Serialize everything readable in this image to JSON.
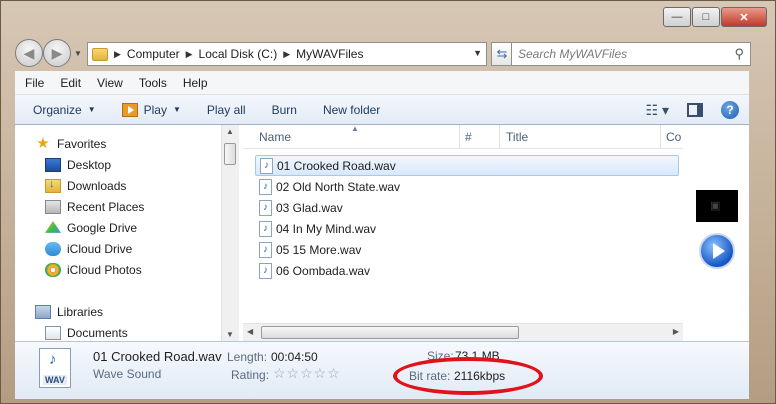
{
  "window": {
    "controls": {
      "minimize": "—",
      "maximize": "□",
      "close": "✕"
    }
  },
  "address": {
    "crumbs": [
      "Computer",
      "Local Disk (C:)",
      "MyWAVFiles"
    ],
    "search_placeholder": "Search MyWAVFiles"
  },
  "menu": [
    "File",
    "Edit",
    "View",
    "Tools",
    "Help"
  ],
  "toolbar": {
    "organize": "Organize",
    "play": "Play",
    "play_all": "Play all",
    "burn": "Burn",
    "new_folder": "New folder"
  },
  "nav": {
    "favorites_label": "Favorites",
    "favorites": [
      "Desktop",
      "Downloads",
      "Recent Places",
      "Google Drive",
      "iCloud Drive",
      "iCloud Photos"
    ],
    "libraries_label": "Libraries",
    "libraries": [
      "Documents"
    ]
  },
  "columns": {
    "name": "Name",
    "number": "#",
    "title": "Title",
    "contributing": "Co"
  },
  "files": [
    "01 Crooked Road.wav",
    "02 Old North State.wav",
    "03 Glad.wav",
    "04 In My Mind.wav",
    "05 15 More.wav",
    "06 Oombada.wav"
  ],
  "details": {
    "filename": "01 Crooked Road.wav",
    "type": "Wave Sound",
    "length_label": "Length:",
    "length": "00:04:50",
    "size_label": "Size:",
    "size": "73.1 MB",
    "rating_label": "Rating:",
    "rating_stars": "☆☆☆☆☆",
    "bitrate_label": "Bit rate:",
    "bitrate": "2116kbps",
    "icon_text": "WAV"
  },
  "icons": {
    "back": "back-arrow-icon",
    "forward": "forward-arrow-icon",
    "search": "search-icon",
    "help": "help-icon"
  }
}
